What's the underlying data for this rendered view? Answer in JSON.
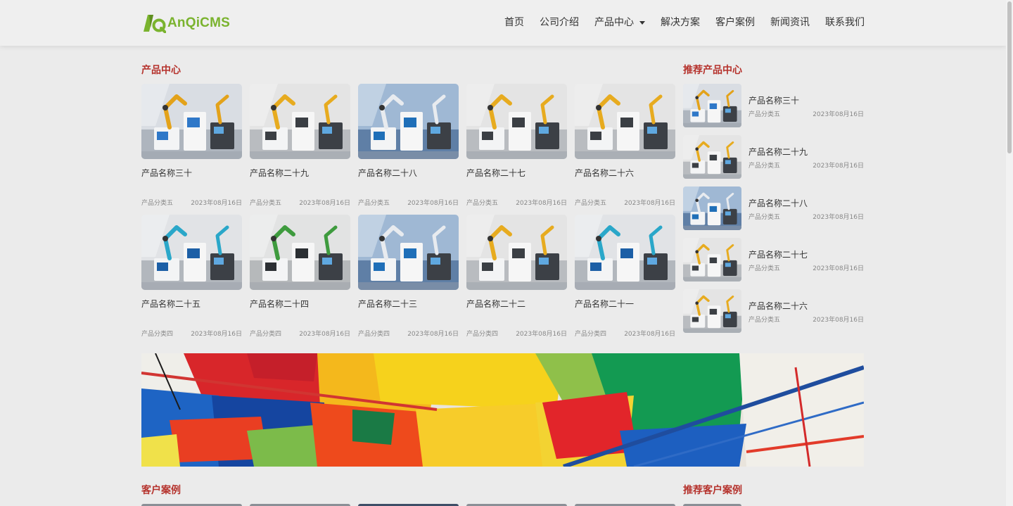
{
  "brand": {
    "logo_text": "AnQiCMS",
    "accent": "#7ab32e"
  },
  "nav": {
    "items": [
      "首页",
      "公司介绍",
      "产品中心",
      "解决方案",
      "客户案例",
      "新闻资讯",
      "联系我们"
    ],
    "dropdown_index": 2
  },
  "colors": {
    "section_title": "#b5322c",
    "page_bg": "#ebebeb"
  },
  "products": {
    "title": "产品中心",
    "items": [
      {
        "name": "产品名称三十",
        "category": "产品分类五",
        "date": "2023年08月16日",
        "tone": "cool"
      },
      {
        "name": "产品名称二十九",
        "category": "产品分类五",
        "date": "2023年08月16日",
        "tone": "yellow"
      },
      {
        "name": "产品名称二十八",
        "category": "产品分类五",
        "date": "2023年08月16日",
        "tone": "blue"
      },
      {
        "name": "产品名称二十七",
        "category": "产品分类五",
        "date": "2023年08月16日",
        "tone": "yellow"
      },
      {
        "name": "产品名称二十六",
        "category": "产品分类五",
        "date": "2023年08月16日",
        "tone": "yellow"
      },
      {
        "name": "产品名称二十五",
        "category": "产品分类四",
        "date": "2023年08月16日",
        "tone": "teal"
      },
      {
        "name": "产品名称二十四",
        "category": "产品分类四",
        "date": "2023年08月16日",
        "tone": "green"
      },
      {
        "name": "产品名称二十三",
        "category": "产品分类四",
        "date": "2023年08月16日",
        "tone": "blue"
      },
      {
        "name": "产品名称二十二",
        "category": "产品分类四",
        "date": "2023年08月16日",
        "tone": "yellow"
      },
      {
        "name": "产品名称二十一",
        "category": "产品分类四",
        "date": "2023年08月16日",
        "tone": "teal"
      }
    ]
  },
  "recommended_products": {
    "title": "推荐产品中心",
    "items": [
      {
        "name": "产品名称三十",
        "category": "产品分类五",
        "date": "2023年08月16日",
        "tone": "cool"
      },
      {
        "name": "产品名称二十九",
        "category": "产品分类五",
        "date": "2023年08月16日",
        "tone": "yellow"
      },
      {
        "name": "产品名称二十八",
        "category": "产品分类五",
        "date": "2023年08月16日",
        "tone": "blue"
      },
      {
        "name": "产品名称二十七",
        "category": "产品分类五",
        "date": "2023年08月16日",
        "tone": "yellow"
      },
      {
        "name": "产品名称二十六",
        "category": "产品分类五",
        "date": "2023年08月16日",
        "tone": "yellow"
      }
    ]
  },
  "cases": {
    "title": "客户案例"
  },
  "recommended_cases": {
    "title": "推荐客户案例"
  }
}
